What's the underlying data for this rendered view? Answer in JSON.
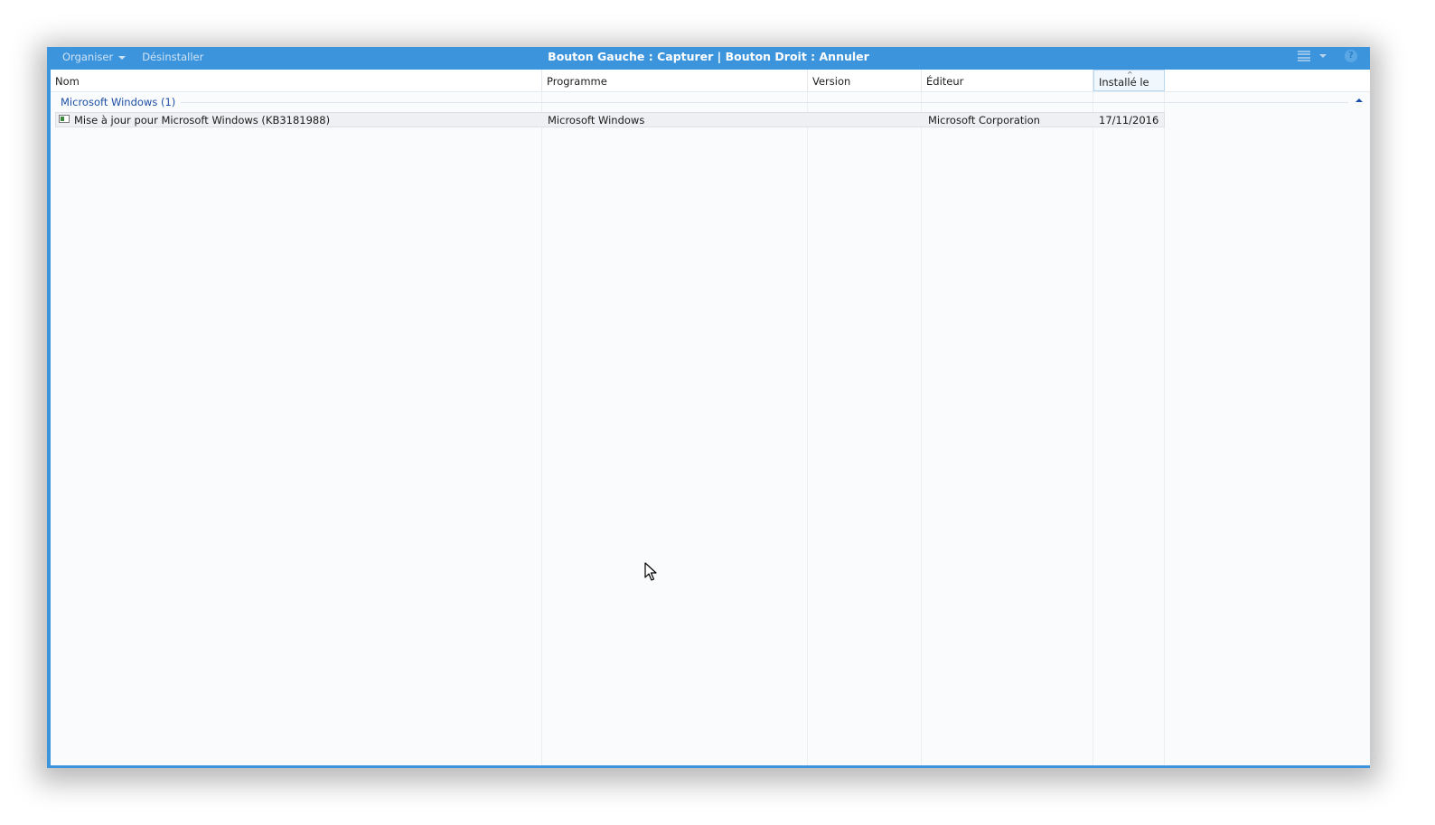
{
  "toolbar": {
    "organize_label": "Organiser",
    "uninstall_label": "Désinstaller",
    "title": "Bouton Gauche : Capturer | Bouton Droit : Annuler",
    "view_icon": "details-view-icon",
    "help_icon": "help-icon",
    "help_glyph": "?"
  },
  "columns": {
    "name": "Nom",
    "program": "Programme",
    "version": "Version",
    "publisher": "Éditeur",
    "installed_on": "Installé le",
    "sort_glyph": "^"
  },
  "groups": [
    {
      "label": "Microsoft Windows (1)",
      "rows": [
        {
          "name": "Mise à jour pour Microsoft Windows (KB3181988)",
          "program": "Microsoft Windows",
          "version": "",
          "publisher": "Microsoft Corporation",
          "installed_on": "17/11/2016"
        }
      ]
    }
  ],
  "colors": {
    "chrome": "#3c94dc",
    "group_text": "#1e4fa6"
  }
}
